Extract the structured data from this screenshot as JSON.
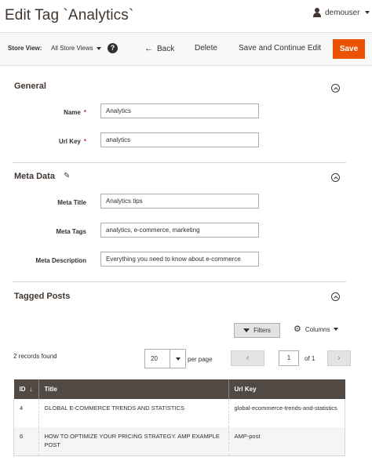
{
  "header": {
    "title": "Edit Tag `Analytics`",
    "user": "demouser"
  },
  "actions": {
    "store_view_label": "Store View:",
    "store_view_value": "All Store Views",
    "help": "?",
    "back": "Back",
    "delete": "Delete",
    "save_continue": "Save and Continue Edit",
    "save": "Save"
  },
  "general": {
    "title": "General",
    "name_label": "Name",
    "name_value": "Analytics",
    "urlkey_label": "Url Key",
    "urlkey_value": "analytics",
    "required_mark": "*"
  },
  "meta": {
    "title": "Meta Data",
    "meta_title_label": "Meta Title",
    "meta_title_value": "Analytics tips",
    "meta_tags_label": "Meta Tags",
    "meta_tags_value": "analytics, e-commerce, marketing",
    "meta_desc_label": "Meta Description",
    "meta_desc_value": "Everything you need to know about e-commerce"
  },
  "tagged": {
    "title": "Tagged Posts",
    "filters": "Filters",
    "columns": "Columns",
    "records_found": "2 records found",
    "per_page_value": "20",
    "per_page_label": "per page",
    "page_value": "1",
    "page_of": "of 1",
    "prev": "‹",
    "next": "›",
    "table": {
      "headers": [
        "ID",
        "Title",
        "Url Key"
      ],
      "sort_indicator": "↓",
      "rows": [
        {
          "id": "4",
          "title": "GLOBAL E-COMMERCE TRENDS AND STATISTICS",
          "url_key": "global-ecommerce-trends-and-statistics"
        },
        {
          "id": "6",
          "title": "HOW TO OPTIMIZE YOUR PRICING STRATEGY. AMP EXAMPLE POST",
          "url_key": "AMP-post"
        }
      ]
    }
  },
  "colors": {
    "accent": "#eb5202",
    "table_header": "#514943",
    "required": "#e22626"
  }
}
